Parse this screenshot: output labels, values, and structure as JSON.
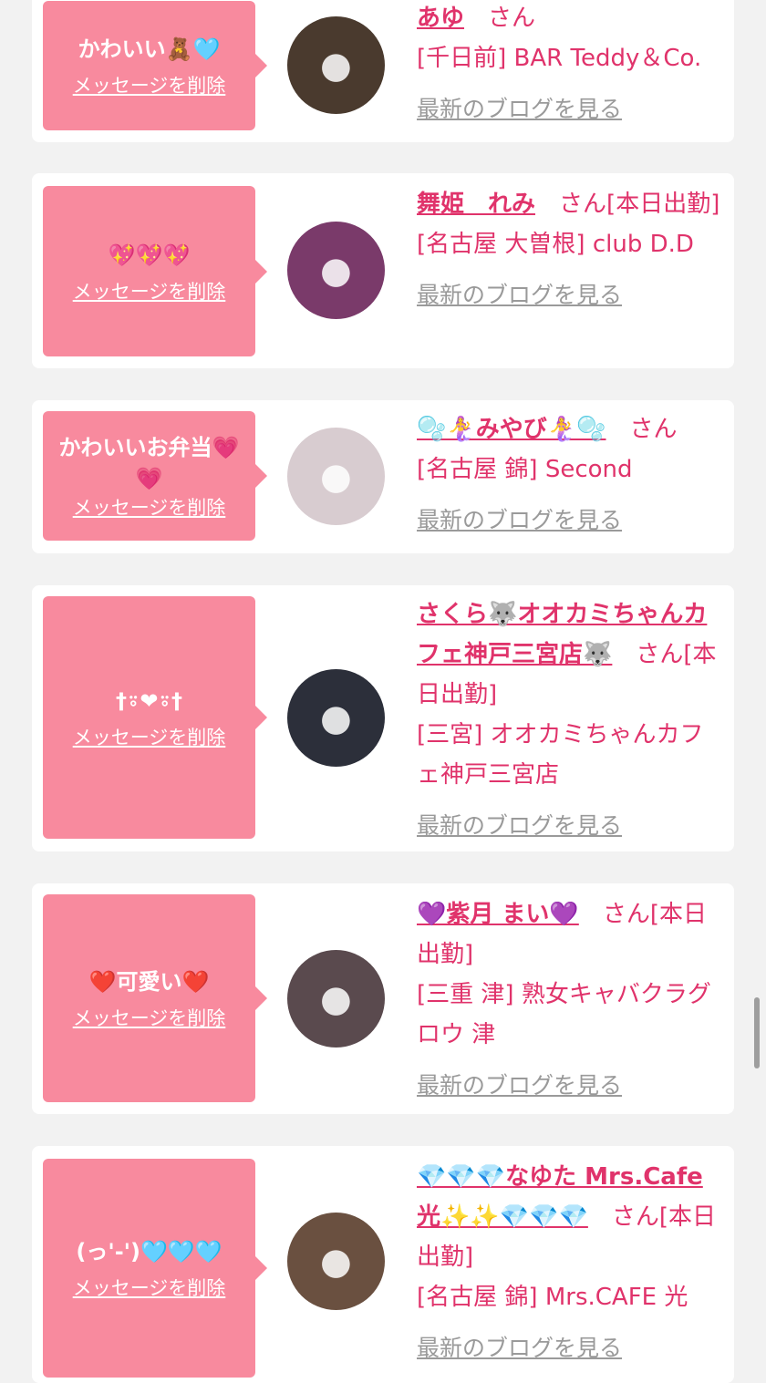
{
  "cards": [
    {
      "message": "かわいい🧸🩵",
      "delete_label": "メッセージを削除",
      "name": "あゆ",
      "suffix": "さん",
      "status": "",
      "shop": "[千日前] BAR Teddy＆Co.",
      "blog_label": "最新のブログを見る",
      "avatar_color": "#4a3a2e"
    },
    {
      "message": "💖💖💖",
      "delete_label": "メッセージを削除",
      "name": "舞姫　れみ",
      "suffix": "さん",
      "status": "[本日出勤]",
      "shop": "[名古屋 大曽根] club D.D",
      "blog_label": "最新のブログを見る",
      "avatar_color": "#7a3a6a"
    },
    {
      "message": "かわいいお弁当💗💗",
      "delete_label": "メッセージを削除",
      "name": "🫧🧜‍♀️みやび🧜‍♀️🫧",
      "suffix": "さん",
      "status": "",
      "shop": "[名古屋 錦] Second",
      "blog_label": "最新のブログを見る",
      "avatar_color": "#d8ccd0"
    },
    {
      "message": "†⍤❤︎⍤†",
      "delete_label": "メッセージを削除",
      "name": "さくら🐺オオカミちゃんカフェ神戸三宮店🐺",
      "suffix": "さん",
      "status": "[本日出勤]",
      "shop": "[三宮] オオカミちゃんカフェ神戸三宮店",
      "blog_label": "最新のブログを見る",
      "avatar_color": "#2c2f3a"
    },
    {
      "message": "❤️可愛い❤️",
      "delete_label": "メッセージを削除",
      "name": "💜紫月 まい💜",
      "suffix": "さん",
      "status": "[本日出勤]",
      "shop": "[三重 津] 熟女キャバクラグロウ 津",
      "blog_label": "最新のブログを見る",
      "avatar_color": "#5a4a4e"
    },
    {
      "message": "(っ'-')🩵🩵🩵",
      "delete_label": "メッセージを削除",
      "name": "💎💎💎なゆた Mrs.Cafe光✨✨💎💎💎",
      "suffix": "さん",
      "status": "[本日出勤]",
      "shop": "[名古屋 錦] Mrs.CAFE 光",
      "blog_label": "最新のブログを見る",
      "avatar_color": "#6a5040"
    }
  ]
}
